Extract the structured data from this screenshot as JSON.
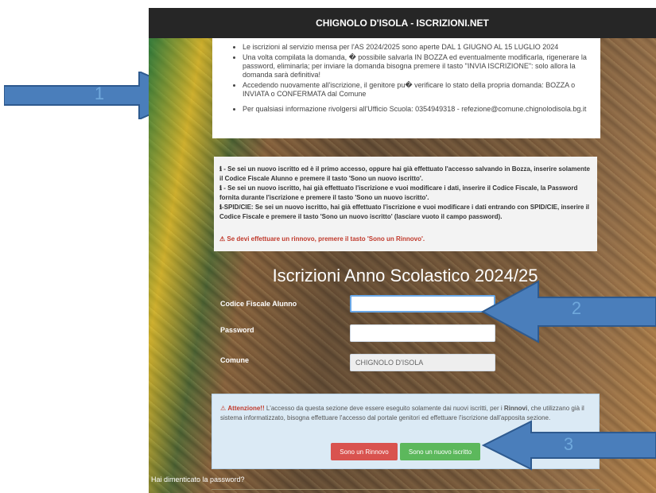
{
  "header": {
    "title": "CHIGNOLO D'ISOLA - ISCRIZIONI.NET"
  },
  "info": {
    "items": [
      "Le iscrizioni al servizio mensa per l'AS 2024/2025 sono aperte DAL 1 GIUGNO AL 15 LUGLIO 2024",
      "Una volta compilata la domanda, � possibile salvarla IN BOZZA ed eventualmente modificarla, rigenerare la password, eliminarla; per inviare la domanda bisogna premere il tasto \"INVIA ISCRIZIONE\": solo allora la domanda sarà definitiva!",
      "Accedendo nuovamente all'iscrizione, il genitore pu� verificare lo stato della propria domanda: BOZZA o INVIATA o CONFERMATA dal Comune",
      "Per qualsiasi informazione rivolgersi all'Ufficio Scuola: 0354949318 - refezione@comune.chignolodisola.bg.it"
    ]
  },
  "notice": {
    "line1": "ℹ - Se sei un nuovo iscritto ed è il primo accesso, oppure hai già effettuato l'accesso salvando in Bozza, inserire solamente il Codice Fiscale Alunno e premere il tasto 'Sono un nuovo iscritto'.",
    "line2": "ℹ - Se sei un nuovo iscritto, hai già effettuato l'iscrizione e vuoi modificare i dati, inserire il Codice Fiscale, la Password fornita durante l'iscrizione e premere il tasto 'Sono un nuovo iscritto'.",
    "line3": "ℹ-SPID/CIE: Se sei un nuovo iscritto, hai già effettuato l'iscrizione e vuoi modificare i dati entrando con SPID/CIE, inserire il Codice Fiscale e premere il tasto 'Sono un nuovo iscritto' (lasciare vuoto il campo password).",
    "warning": "⚠ Se devi effettuare un rinnovo, premere il tasto 'Sono un Rinnovo'."
  },
  "form": {
    "title": "Iscrizioni Anno Scolastico 2024/25",
    "codice_label": "Codice Fiscale Alunno",
    "codice_value": "",
    "password_label": "Password",
    "password_value": "",
    "comune_label": "Comune",
    "comune_value": "CHIGNOLO D'ISOLA"
  },
  "attention": {
    "icon": "⚠",
    "bold": "Attenzione!!",
    "text1": " L'accesso da questa sezione deve essere eseguito solamente dai nuovi iscritti, per i ",
    "bold2": "Rinnovi",
    "text2": ", che utilizzano già il sistema informatizzato, bisogna effettuare l'accesso dal portale genitori ed effettuare l'iscrizione dall'apposita sezione."
  },
  "buttons": {
    "renew": "Sono un Rinnovo",
    "new": "Sono un nuovo iscritto"
  },
  "footer": {
    "forgot": "Hai dimenticato la password?"
  },
  "annotations": {
    "label1": "1",
    "label2": "2",
    "label3": "3",
    "arrow_color": "#4a7ebb"
  }
}
